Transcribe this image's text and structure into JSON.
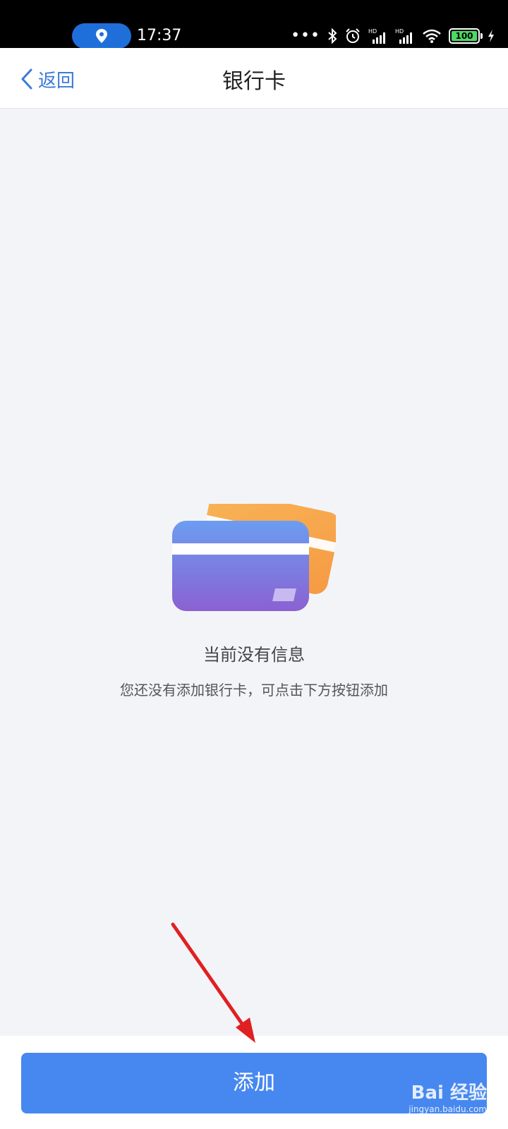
{
  "status_bar": {
    "time": "17:37",
    "battery": "100",
    "icons": [
      "location-icon",
      "more-dots-icon",
      "bluetooth-icon",
      "alarm-icon",
      "hd-signal-icon",
      "hd-signal-icon",
      "wifi-icon",
      "battery-icon",
      "charging-icon"
    ]
  },
  "nav": {
    "back_label": "返回",
    "title": "银行卡"
  },
  "empty_state": {
    "title": "当前没有信息",
    "description": "您还没有添加银行卡，可点击下方按钮添加"
  },
  "actions": {
    "add_label": "添加"
  },
  "watermark": {
    "brand": "Bai 经验",
    "url": "jingyan.baidu.com"
  },
  "colors": {
    "accent": "#4788f0",
    "back_link": "#3b7bd8",
    "background": "#f3f4f8",
    "card_front_top": "#6a9cf0",
    "card_front_bottom": "#8b63d3",
    "card_back": "#f7a24a",
    "annotation_arrow": "#e02020"
  }
}
